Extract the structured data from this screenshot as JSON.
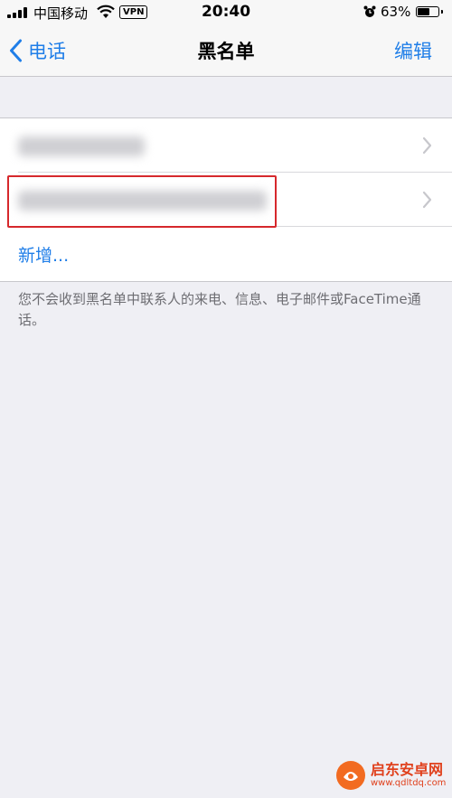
{
  "status_bar": {
    "carrier": "中国移动",
    "vpn_badge": "VPN",
    "time": "20:40",
    "battery_percent_label": "63%",
    "battery_level": 0.63,
    "icons": [
      "signal-icon",
      "wifi-icon",
      "alarm-icon",
      "battery-icon"
    ]
  },
  "nav": {
    "back_label": "电话",
    "title": "黑名单",
    "edit_label": "编辑"
  },
  "blocked_list": {
    "add_label": "新增...",
    "row_count_hint": 2
  },
  "footer": {
    "note": "您不会收到黑名单中联系人的来电、信息、电子邮件或FaceTime通话。"
  },
  "watermark": {
    "title": "启东安卓网",
    "url": "www.qdltdq.com"
  },
  "colors": {
    "accent": "#1f7ee8",
    "highlight": "#d6282c",
    "background": "#efeff4"
  }
}
